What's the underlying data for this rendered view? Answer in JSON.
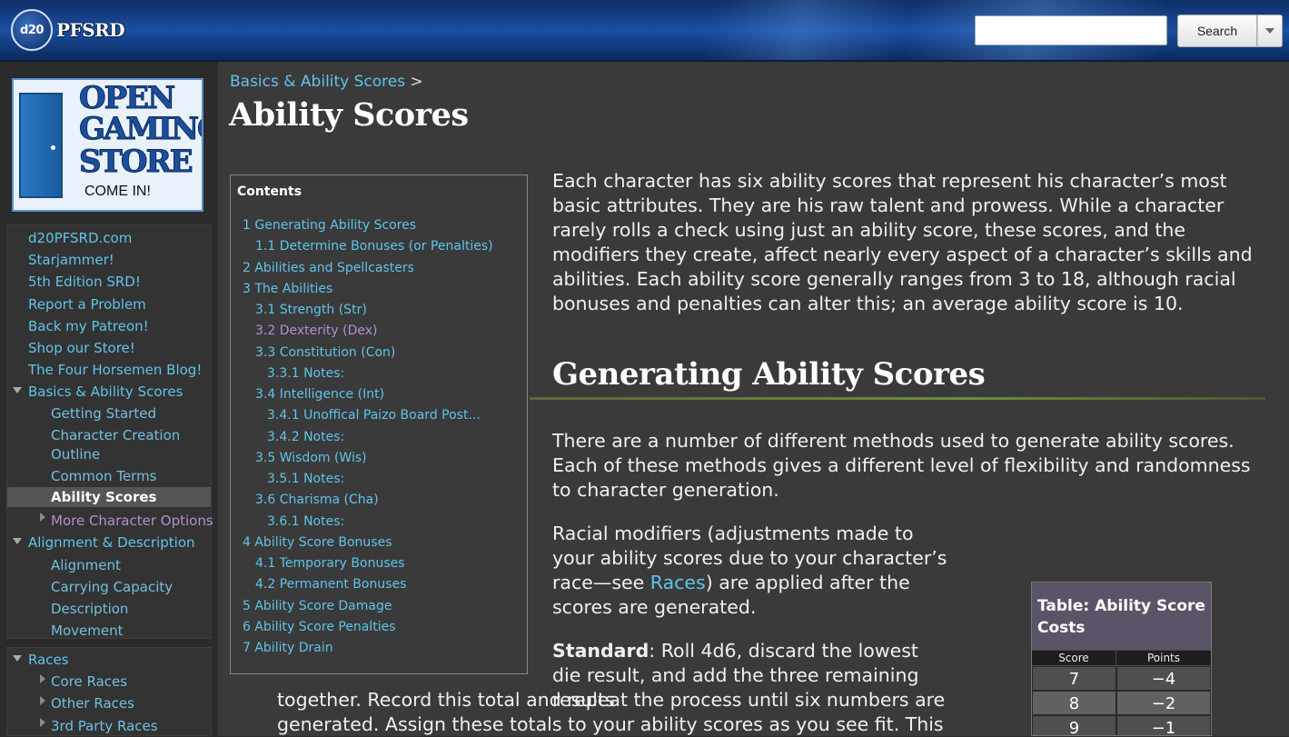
{
  "header": {
    "logo_die": "d20",
    "logo_text": "PFSRD",
    "search_placeholder": "",
    "search_button": "Search"
  },
  "ad": {
    "line1": "OPEN",
    "line2": "GAMING",
    "line3": "STORE",
    "line4": "COME IN!"
  },
  "sidebar": {
    "links": [
      "d20PFSRD.com",
      "Starjammer!",
      "5th Edition SRD!",
      "Report a Problem",
      "Back my Patreon!",
      "Shop our Store!",
      "The Four Horsemen Blog!"
    ],
    "basics_label": "Basics & Ability Scores",
    "basics_children": [
      "Getting Started",
      "Character Creation",
      "Outline",
      "Common Terms",
      "Ability Scores",
      "More Character Options"
    ],
    "alignment_label": "Alignment & Description",
    "alignment_children": [
      "Alignment",
      "Carrying Capacity",
      "Description",
      "Movement"
    ],
    "races_label": "Races",
    "races_children": [
      "Core Races",
      "Other Races",
      "3rd Party Races"
    ]
  },
  "main": {
    "breadcrumb_link": "Basics & Ability Scores",
    "breadcrumb_sep": ">",
    "title": "Ability Scores",
    "intro": "Each character has six ability scores that represent his character’s most basic attributes. They are his raw talent and prowess. While a character rarely rolls a check using just an ability score, these scores, and the modifiers they create, affect nearly every aspect of a character’s skills and abilities. Each ability score generally ranges from 3 to 18, although racial bonuses and penalties can alter this; an average ability score is 10.",
    "h2": "Generating Ability Scores",
    "p2": "There are a number of different methods used to generate ability scores. Each of these methods gives a different level of flexibility and randomness to character generation.",
    "p3_a": "Racial modifiers (adjustments made to your ability scores due to your character’s race—see ",
    "p3_link": "Races",
    "p3_b": ") are applied after the scores are generated.",
    "p4_bold": "Standard",
    "p4": ": Roll 4d6, discard the lowest die result, and add the three remaining results",
    "p4_cont1": "together. Record this total and repeat the process until six numbers are",
    "p4_cont2": "generated. Assign these totals to your ability scores as you see fit. This"
  },
  "toc": {
    "heading": "Contents",
    "items": [
      "1 Generating Ability Scores",
      "1.1 Determine Bonuses (or Penalties)",
      "2 Abilities and Spellcasters",
      "3 The Abilities",
      "3.1 Strength (Str)",
      "3.2 Dexterity (Dex)",
      "3.3 Constitution (Con)",
      "3.3.1 Notes:",
      "3.4 Intelligence (Int)",
      "3.4.1 Unoffical Paizo Board Post...",
      "3.4.2 Notes:",
      "3.5 Wisdom (Wis)",
      "3.5.1 Notes:",
      "3.6 Charisma (Cha)",
      "3.6.1 Notes:",
      "4 Ability Score Bonuses",
      "4.1 Temporary Bonuses",
      "4.2 Permanent Bonuses",
      "5 Ability Score Damage",
      "6 Ability Score Penalties",
      "7 Ability Drain"
    ]
  },
  "table": {
    "caption": "Table: Ability Score Costs",
    "col_score": "Score",
    "col_points": "Points",
    "rows": [
      [
        "7",
        "−4"
      ],
      [
        "8",
        "−2"
      ],
      [
        "9",
        "−1"
      ]
    ]
  }
}
